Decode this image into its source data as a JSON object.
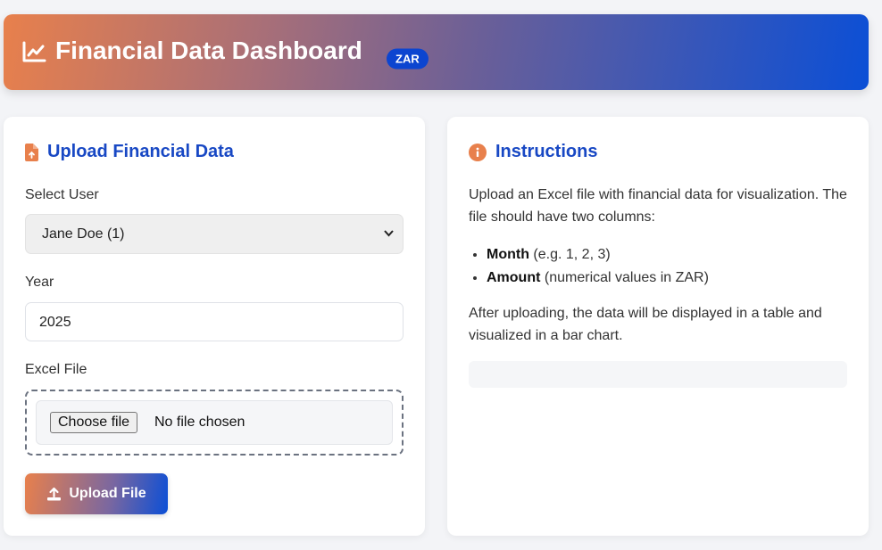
{
  "header": {
    "title": "Financial Data Dashboard",
    "currency_badge": "ZAR",
    "icon": "chart-line-icon"
  },
  "upload": {
    "title": "Upload Financial Data",
    "icon": "file-upload-icon",
    "user_label": "Select User",
    "user_selected": "Jane Doe (1)",
    "year_label": "Year",
    "year_value": "2025",
    "file_label": "Excel File",
    "choose_file_label": "Choose file",
    "file_status": "No file chosen",
    "submit_label": "Upload File"
  },
  "instructions": {
    "title": "Instructions",
    "icon": "info-circle-icon",
    "intro": "Upload an Excel file with financial data for visualization. The file should have two columns:",
    "columns": [
      {
        "name": "Month",
        "desc": " (e.g. 1, 2, 3)"
      },
      {
        "name": "Amount",
        "desc": " (numerical values in ZAR)"
      }
    ],
    "outro": "After uploading, the data will be displayed in a table and visualized in a bar chart."
  },
  "colors": {
    "accent_orange": "#e8804c",
    "accent_blue": "#0b4fd6",
    "title_blue": "#1848c4"
  }
}
